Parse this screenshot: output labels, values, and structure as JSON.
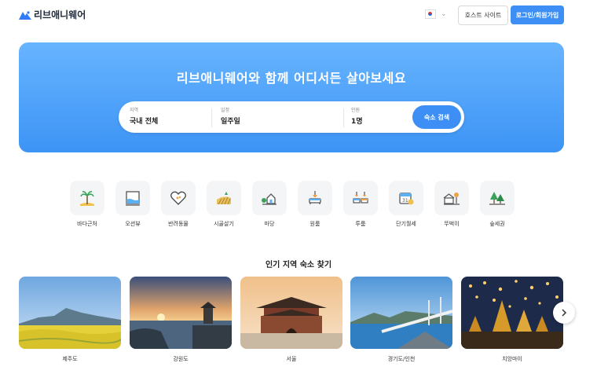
{
  "header": {
    "logo_text": "리브애니웨어",
    "host_site_label": "호스트 사이트",
    "login_label": "로그인/회원가입"
  },
  "hero": {
    "title": "리브애니웨어와 함께 어디서든 살아보세요",
    "search": {
      "region_label": "지역",
      "region_value": "국내 전체",
      "period_label": "일정",
      "period_value": "일주일",
      "guests_label": "인원",
      "guests_value": "1명",
      "button_label": "숙소 검색"
    }
  },
  "categories": [
    {
      "label": "바다근처",
      "icon": "palm-beach-icon"
    },
    {
      "label": "오션뷰",
      "icon": "ocean-view-icon"
    },
    {
      "label": "반려동물",
      "icon": "pet-heart-icon"
    },
    {
      "label": "시골살기",
      "icon": "countryside-icon"
    },
    {
      "label": "마당",
      "icon": "yard-house-icon"
    },
    {
      "label": "원룸",
      "icon": "one-room-icon"
    },
    {
      "label": "투룸",
      "icon": "two-room-icon"
    },
    {
      "label": "단기월세",
      "icon": "monthly-rent-icon"
    },
    {
      "label": "뚜벅이",
      "icon": "walker-icon"
    },
    {
      "label": "숲세권",
      "icon": "forest-icon"
    }
  ],
  "popular": {
    "title": "인기 지역 숙소 찾기",
    "regions": [
      {
        "label": "제주도"
      },
      {
        "label": "강원도"
      },
      {
        "label": "서울"
      },
      {
        "label": "경기도/인천"
      },
      {
        "label": "치앙마이"
      }
    ]
  },
  "colors": {
    "accent": "#3d8ff5",
    "hero_top": "#67b4ff",
    "hero_bottom": "#3d94f5"
  }
}
